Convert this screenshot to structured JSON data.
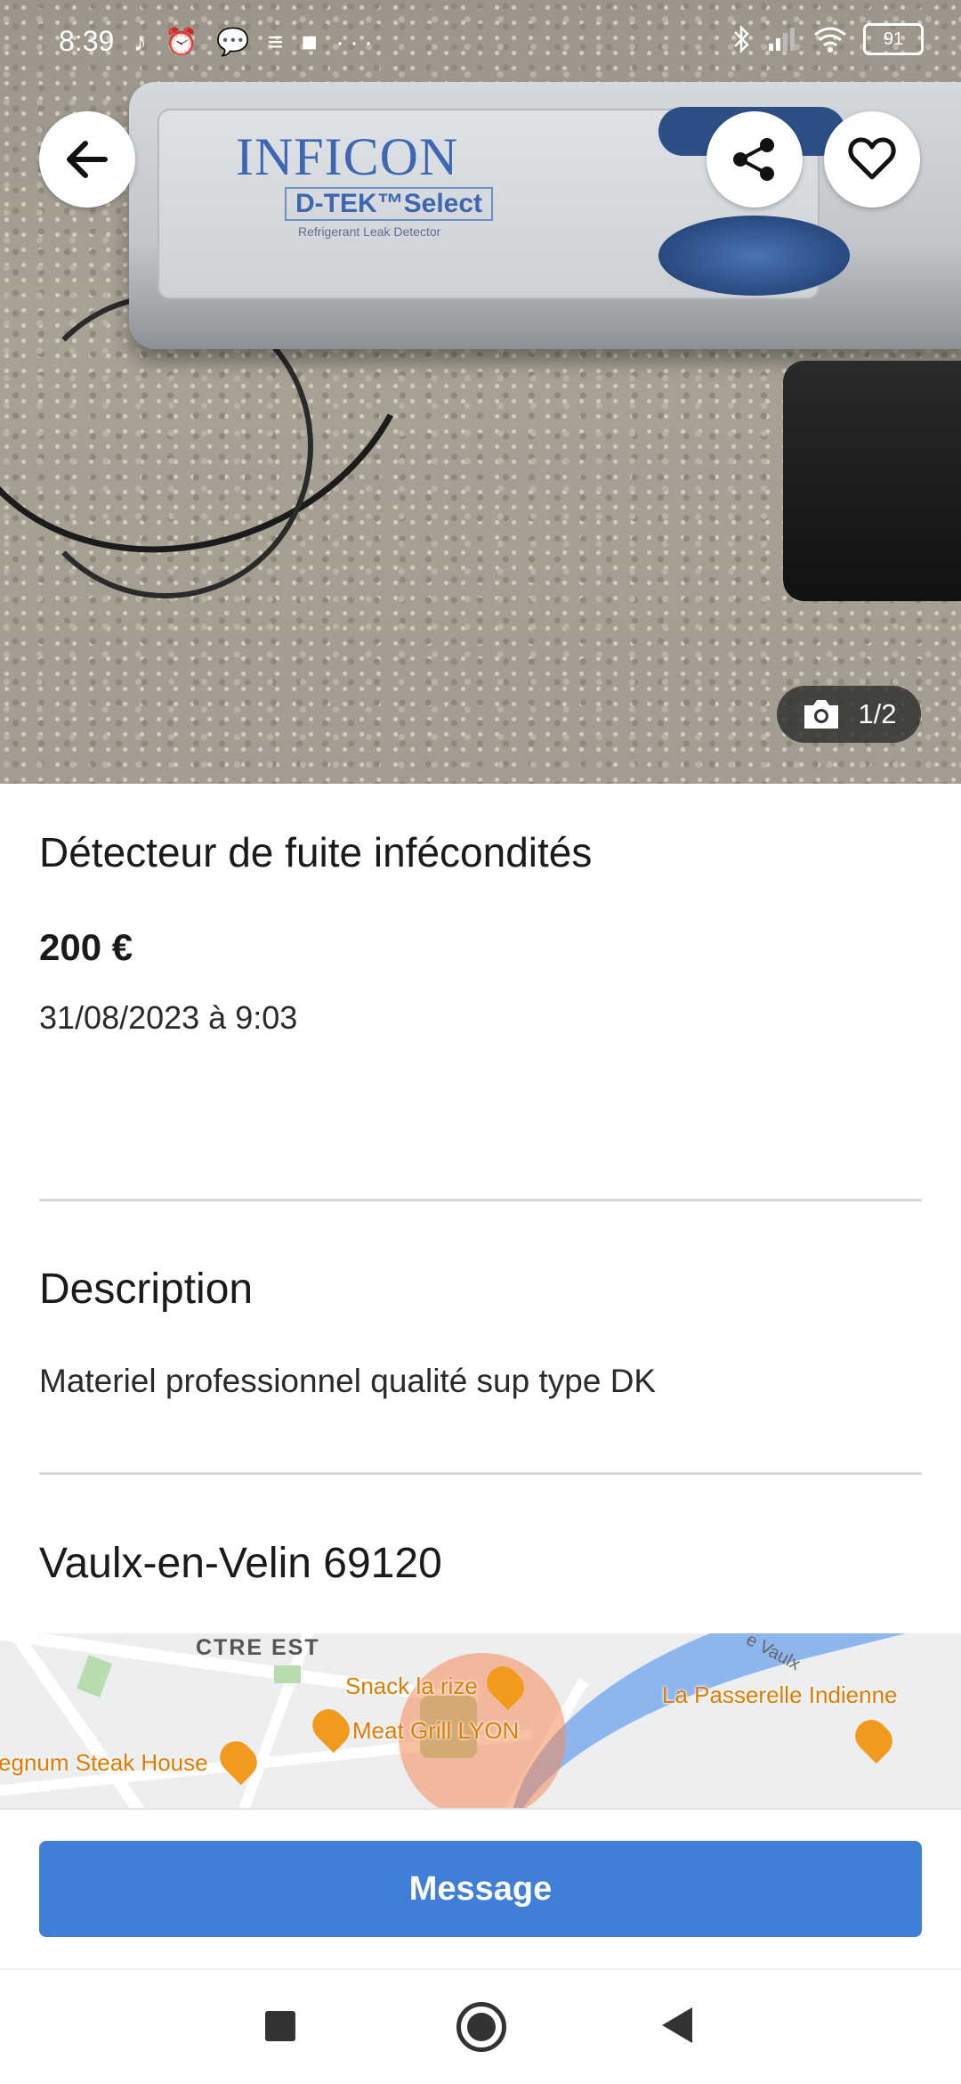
{
  "status_bar": {
    "time": "8:39",
    "left_icons": "♪ ⏰ 💬 ≡ ■ ···",
    "battery": "91"
  },
  "photo": {
    "device_brand": "INFICON",
    "device_model": "D-TEK™Select",
    "device_sub": "Refrigerant Leak Detector",
    "counter": "1/2",
    "icons": {
      "back": "arrow-left-icon",
      "share": "share-icon",
      "favorite": "heart-icon",
      "camera": "camera-icon"
    }
  },
  "listing": {
    "title": "Détecteur de fuite infécondités",
    "price": "200 €",
    "date": "31/08/2023 à 9:03"
  },
  "description": {
    "heading": "Description",
    "text": "Materiel professionnel qualité sup type DK"
  },
  "location": {
    "title": "Vaulx-en-Velin 69120"
  },
  "map": {
    "labels": {
      "ctre_est": "CTRE EST",
      "snack": "Snack la rize",
      "meat_grill": "Meat Grill LYON",
      "steak_house": "egnum Steak House",
      "passerelle": "La Passerelle Indienne",
      "vaulx": "e Vaulx"
    }
  },
  "actions": {
    "message": "Message"
  },
  "nav": {
    "recent": "square-icon",
    "home": "circle-icon",
    "back": "triangle-back-icon"
  },
  "colors": {
    "primary": "#3f7fd7",
    "poi": "#f29a1d"
  }
}
